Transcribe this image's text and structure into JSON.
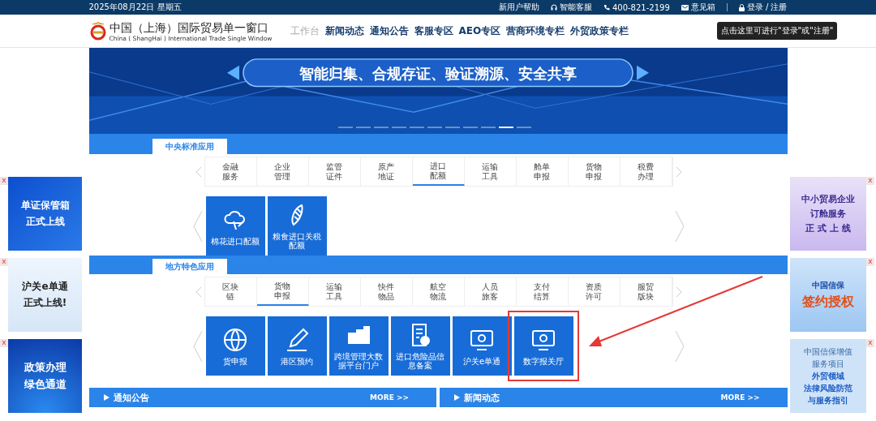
{
  "top_bar": {
    "date": "2025年08月22日 星期五",
    "links": [
      {
        "kind": "plain",
        "label": "新用户帮助"
      },
      {
        "kind": "headset",
        "label": "智能客服"
      },
      {
        "kind": "phone",
        "label": "400-821-2199"
      },
      {
        "kind": "mail",
        "label": "意见箱"
      },
      {
        "kind": "lock",
        "label": "登录 / 注册"
      }
    ],
    "tooltip": "点击这里可进行\"登录\"或\"注册\""
  },
  "header": {
    "title": "中国（上海）国际贸易单一窗口",
    "subtitle": "China ( ShangHai ) International Trade Single Window",
    "nav": [
      {
        "label": "工作台",
        "selected": true
      },
      {
        "label": "新闻动态",
        "selected": false
      },
      {
        "label": "通知公告",
        "selected": false
      },
      {
        "label": "客服专区",
        "selected": false
      },
      {
        "label": "AEO专区",
        "selected": false
      },
      {
        "label": "营商环境专栏",
        "selected": false
      },
      {
        "label": "外贸政策专栏",
        "selected": false
      }
    ]
  },
  "banner": {
    "slogan": "智能归集、合规存证、验证溯源、安全共享",
    "slides": [
      {
        "selected": false
      },
      {
        "selected": false
      },
      {
        "selected": false
      },
      {
        "selected": false
      },
      {
        "selected": false
      },
      {
        "selected": false
      },
      {
        "selected": false
      },
      {
        "selected": false
      },
      {
        "selected": false
      },
      {
        "selected": true
      },
      {
        "selected": false
      }
    ]
  },
  "sections": [
    {
      "title": "中央标准应用",
      "categories": [
        {
          "label": "金融服务",
          "selected": false
        },
        {
          "label": "企业管理",
          "selected": false
        },
        {
          "label": "监管证件",
          "selected": false
        },
        {
          "label": "原产地证",
          "selected": false
        },
        {
          "label": "进口配额",
          "selected": true
        },
        {
          "label": "运输工具",
          "selected": false
        },
        {
          "label": "舱单申报",
          "selected": false
        },
        {
          "label": "货物申报",
          "selected": false
        },
        {
          "label": "税费办理",
          "selected": false
        }
      ],
      "tiles": [
        {
          "label": "棉花进口配额"
        },
        {
          "label": "粮食进口关税配额"
        }
      ]
    },
    {
      "title": "地方特色应用",
      "categories": [
        {
          "label": "区块链",
          "selected": false
        },
        {
          "label": "货物申报",
          "selected": true
        },
        {
          "label": "运输工具",
          "selected": false
        },
        {
          "label": "快件物品",
          "selected": false
        },
        {
          "label": "航空物流",
          "selected": false
        },
        {
          "label": "人员旅客",
          "selected": false
        },
        {
          "label": "支付结算",
          "selected": false
        },
        {
          "label": "资质许可",
          "selected": false
        },
        {
          "label": "服贸版块",
          "selected": false
        }
      ],
      "tiles": [
        {
          "label": "货申报"
        },
        {
          "label": "港区预约"
        },
        {
          "label": "跨境管理大数据平台门户"
        },
        {
          "label": "进口危险品信息备案"
        },
        {
          "label": "沪关e单通"
        },
        {
          "label": "数字报关厅"
        }
      ]
    }
  ],
  "news_bars": [
    {
      "title": "通知公告",
      "more": "MORE >>"
    },
    {
      "title": "新闻动态",
      "more": "MORE >>"
    }
  ],
  "left_ads": [
    {
      "lines": [
        "单证保管箱",
        "正式上线"
      ],
      "close": "x"
    },
    {
      "lines": [
        "沪关e单通",
        "正式上线!"
      ],
      "close": "x"
    },
    {
      "lines": [
        "政策办理",
        "绿色通道"
      ],
      "close": "x"
    }
  ],
  "right_ads": [
    {
      "lines": [
        "中小贸易企业",
        "订舱服务",
        "正 式 上 线"
      ],
      "close": "x"
    },
    {
      "lines": [
        "中国信保",
        "签约授权"
      ],
      "close": "x"
    },
    {
      "lines": [
        "中国信保增值",
        "服务项目",
        "外贸领域",
        "法律风险防范",
        "与服务指引"
      ],
      "close": "x"
    }
  ]
}
